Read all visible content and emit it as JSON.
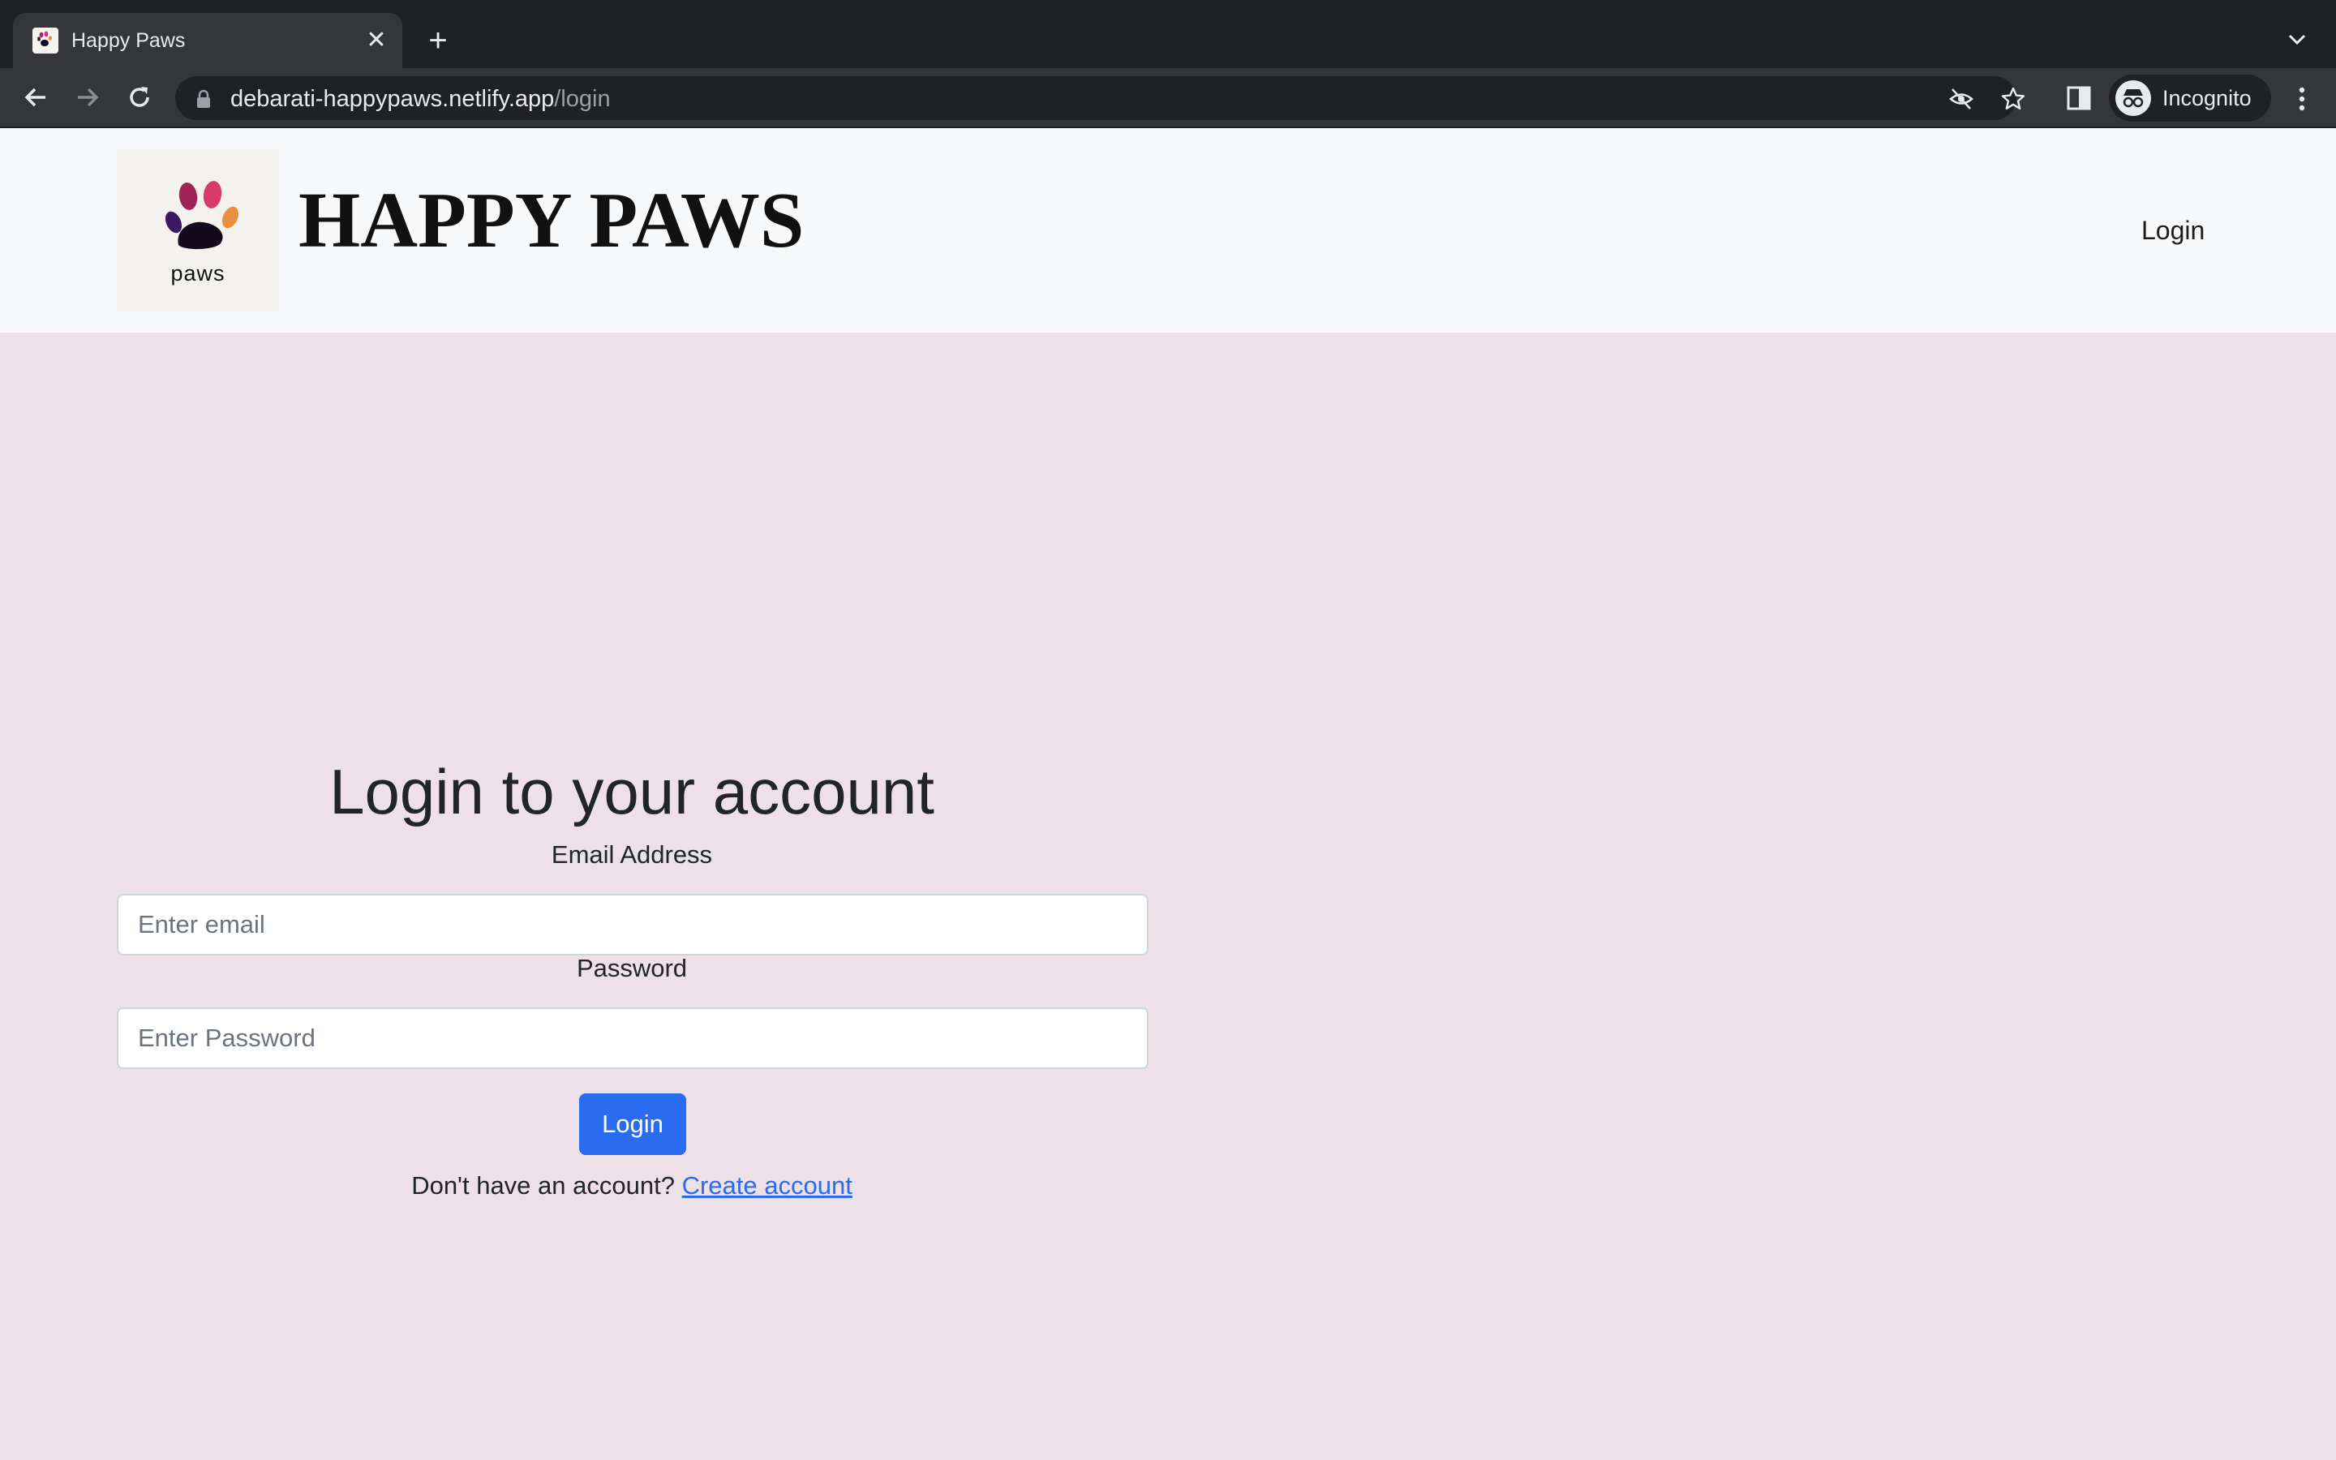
{
  "browser": {
    "tab_title": "Happy Paws",
    "tab_close": "✕",
    "new_tab": "+",
    "url_host": "debarati-happypaws.netlify.app",
    "url_path": "/login",
    "profile_label": "Incognito"
  },
  "navbar": {
    "logo_text": "paws",
    "brand": "HAPPY PAWS",
    "login_link": "Login"
  },
  "login_form": {
    "heading": "Login to your account",
    "email_label": "Email Address",
    "email_placeholder": "Enter email",
    "email_value": "",
    "password_label": "Password",
    "password_placeholder": "Enter Password",
    "password_value": "",
    "submit_label": "Login",
    "signup_prompt": "Don't have an account?",
    "signup_link": "Create account"
  },
  "colors": {
    "page_background": "#ede1e7",
    "navbar_background": "#f8f9fa",
    "primary": "#2a6cf0"
  },
  "icons": [
    "paw-logo-icon",
    "back-arrow-icon",
    "forward-arrow-icon",
    "reload-icon",
    "lock-icon",
    "eye-off-icon",
    "star-icon",
    "side-panel-icon",
    "incognito-icon",
    "kebab-menu-icon",
    "tab-list-chevron-icon"
  ]
}
